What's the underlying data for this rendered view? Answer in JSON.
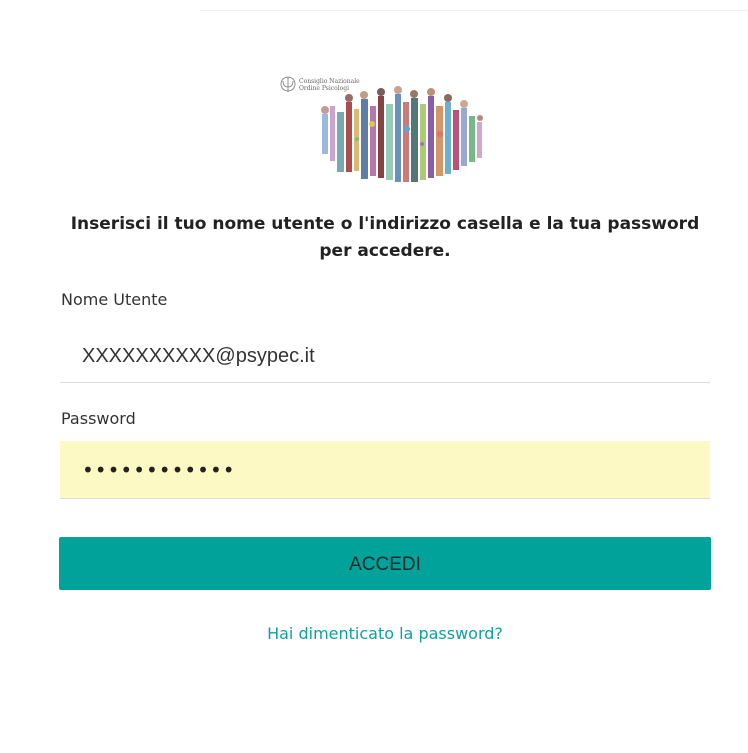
{
  "logo": {
    "line1": "Consiglio Nazionale",
    "line2": "Ordine Psicologi"
  },
  "headline": "Inserisci il tuo nome utente o l'indirizzo casella e la tua password per accedere.",
  "username": {
    "label": "Nome Utente",
    "value": "XXXXXXXXXX@psypec.it"
  },
  "password": {
    "label": "Password",
    "masked_value": "••••••••••••"
  },
  "submit_label": "ACCEDI",
  "forgot_link": "Hai dimenticato la password?",
  "colors": {
    "accent": "#00a29a",
    "link": "#11a0a0",
    "autofill_bg": "#fcf9c5"
  }
}
